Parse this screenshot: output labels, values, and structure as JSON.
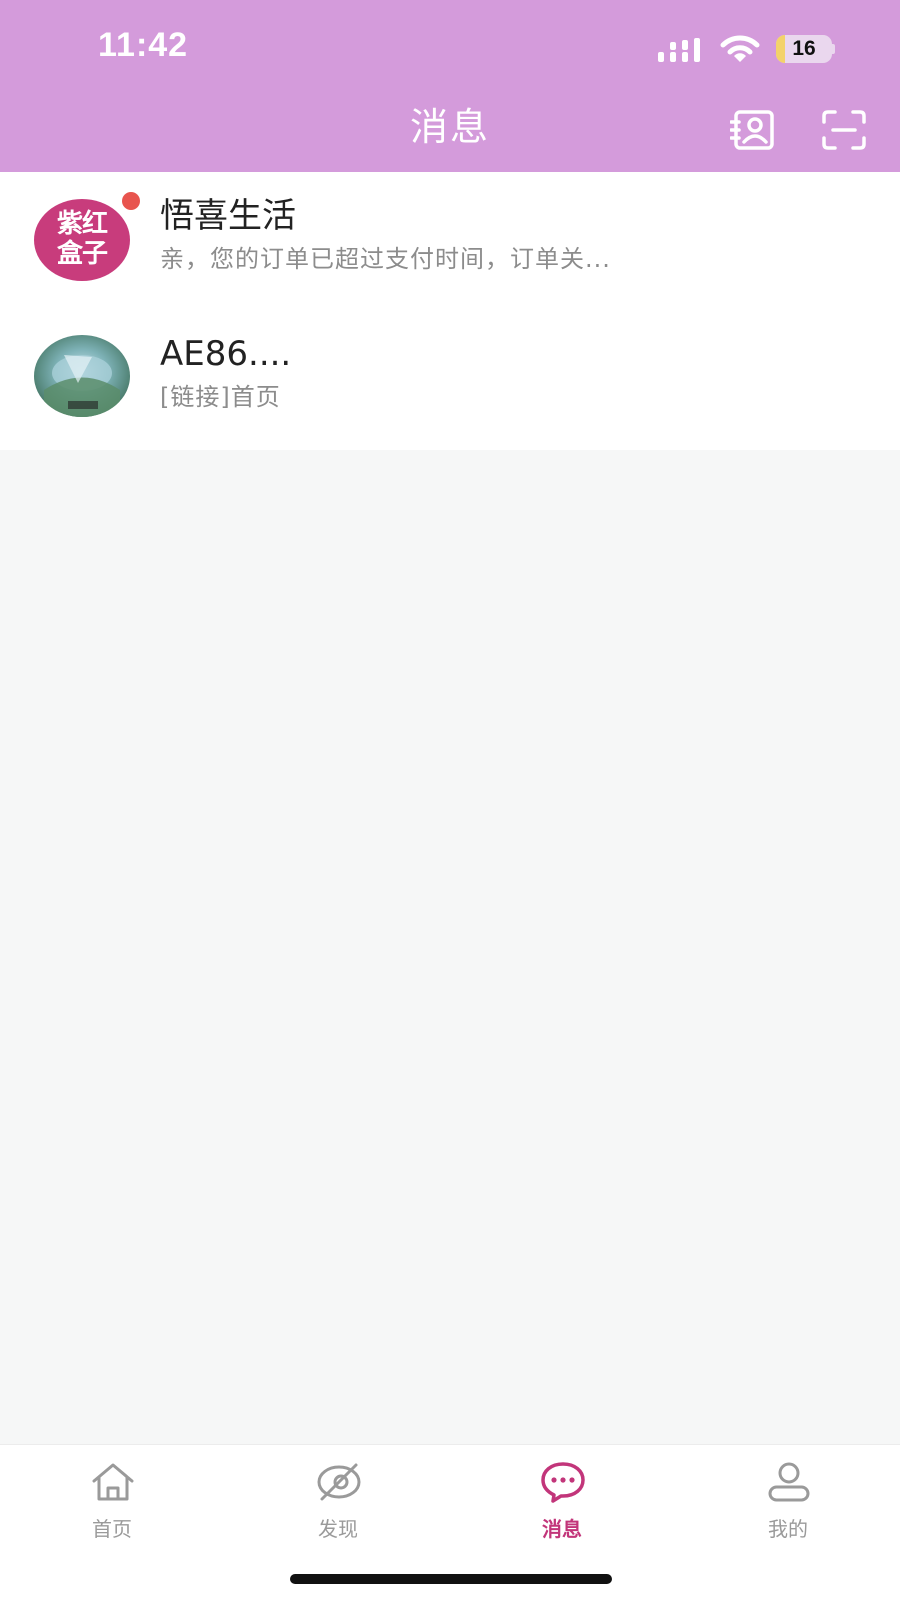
{
  "status_bar": {
    "time": "11:42",
    "battery": "16",
    "signal_icon": "cellular-signal-icon",
    "wifi_icon": "wifi-icon",
    "battery_icon": "battery-icon"
  },
  "header": {
    "title": "消息",
    "background_color": "#d49bdb",
    "actions": [
      {
        "icon": "contacts-book-icon"
      },
      {
        "icon": "scan-icon"
      }
    ]
  },
  "conversations": [
    {
      "avatar_text_line1": "紫红",
      "avatar_text_line2": "盒子",
      "avatar_color": "#c83c7c",
      "name": "悟喜生活",
      "preview": "亲，您的订单已超过支付时间，订单关...",
      "unread": true
    },
    {
      "avatar_icon": "photo-avatar-icon",
      "name": "AE86....",
      "preview": "[链接]首页",
      "unread": false
    }
  ],
  "tabbar": {
    "active_color": "#c2357a",
    "tabs": [
      {
        "label": "首页",
        "icon": "home-icon",
        "active": false
      },
      {
        "label": "发现",
        "icon": "discover-eye-icon",
        "active": false
      },
      {
        "label": "消息",
        "icon": "message-bubble-icon",
        "active": true
      },
      {
        "label": "我的",
        "icon": "profile-icon",
        "active": false
      }
    ]
  }
}
